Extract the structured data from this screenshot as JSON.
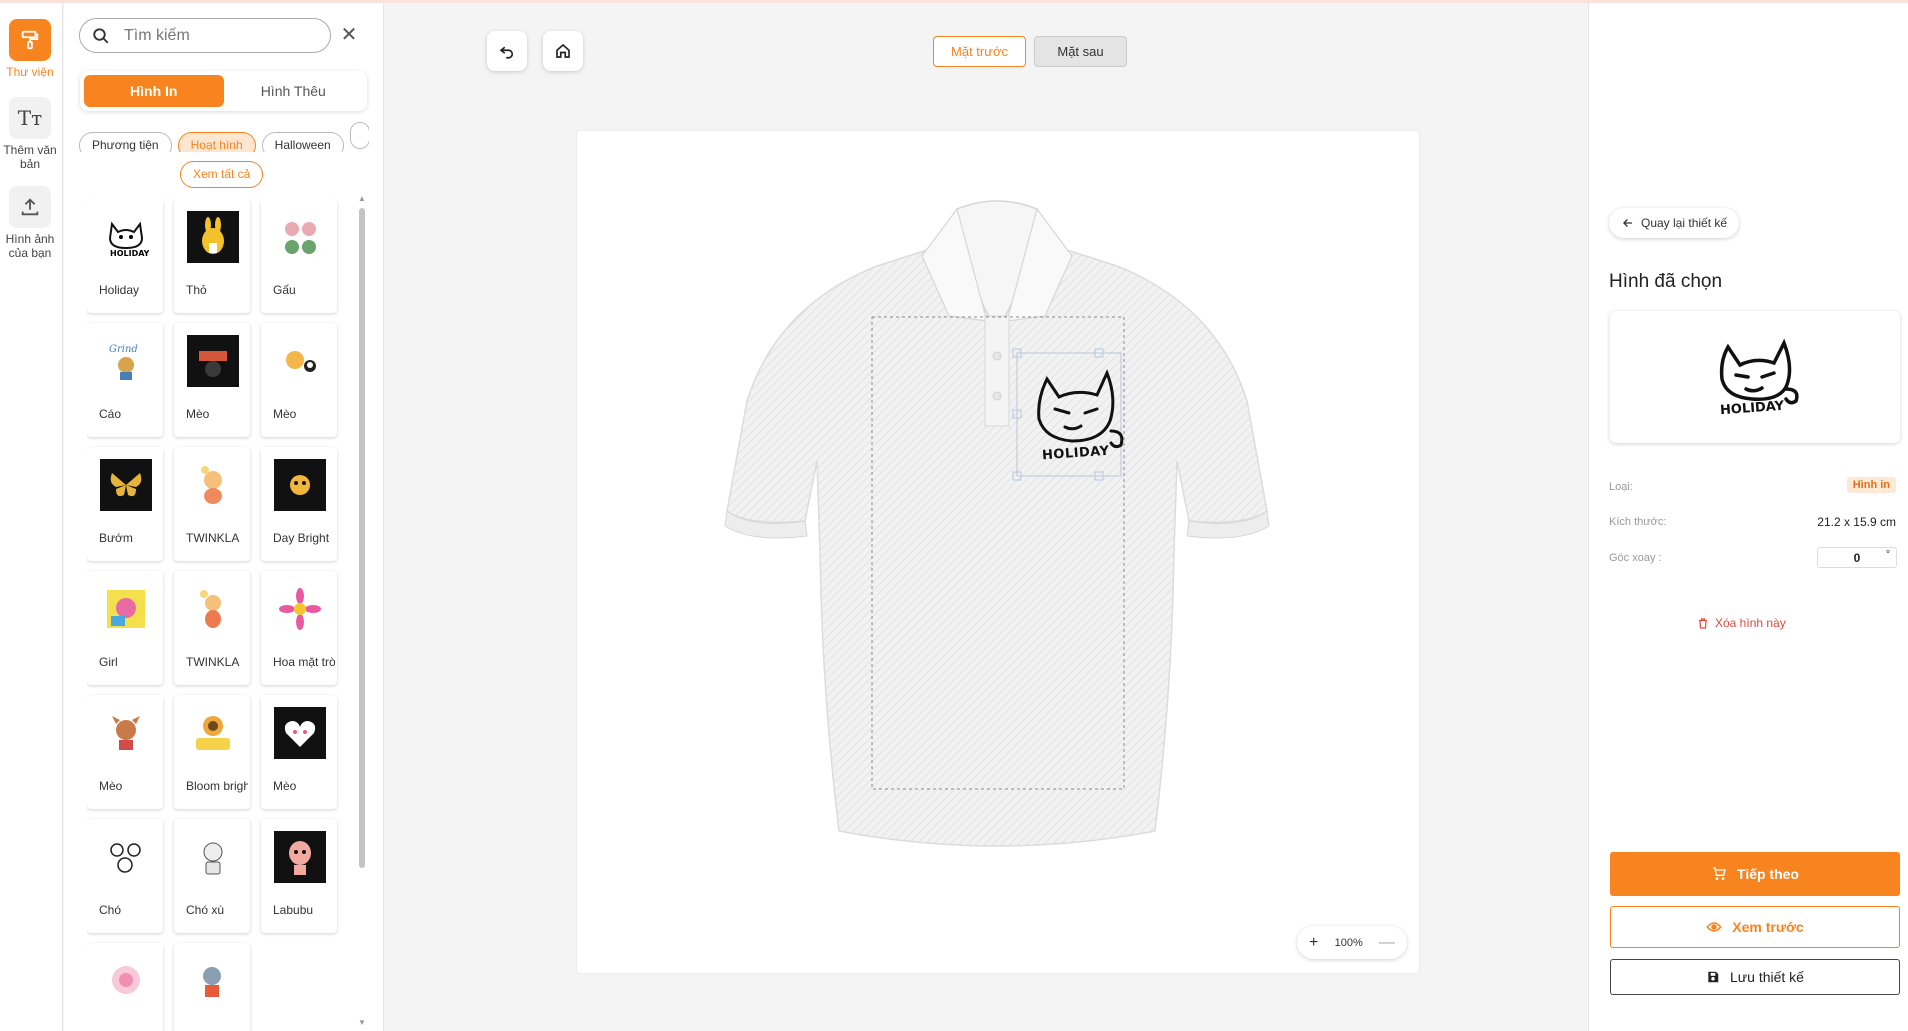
{
  "rail": {
    "items": [
      {
        "label": "Thư viện",
        "icon": "paint-roller-icon"
      },
      {
        "label": "Thêm văn bản",
        "icon": "text-icon"
      },
      {
        "label": "Hình ảnh của bạn",
        "icon": "upload-icon"
      }
    ]
  },
  "library": {
    "search_placeholder": "Tìm kiếm",
    "tabs": [
      {
        "label": "Hình In",
        "active": true
      },
      {
        "label": "Hình Thêu",
        "active": false
      }
    ],
    "categories": [
      {
        "label": "Phương tiện",
        "active": false
      },
      {
        "label": "Hoạt hình",
        "active": true
      },
      {
        "label": "Halloween",
        "active": false
      }
    ],
    "see_all": "Xem tất cả",
    "items": [
      {
        "name": "Holiday"
      },
      {
        "name": "Thỏ"
      },
      {
        "name": "Gấu"
      },
      {
        "name": "Cáo"
      },
      {
        "name": "Mèo"
      },
      {
        "name": "Mèo"
      },
      {
        "name": "Bướm"
      },
      {
        "name": "TWINKLA"
      },
      {
        "name": "Day Bright"
      },
      {
        "name": "Girl"
      },
      {
        "name": "TWINKLA"
      },
      {
        "name": "Hoa mặt trời"
      },
      {
        "name": "Mèo"
      },
      {
        "name": "Bloom bright"
      },
      {
        "name": "Mèo"
      },
      {
        "name": "Chó"
      },
      {
        "name": "Chó xù"
      },
      {
        "name": "Labubu"
      },
      {
        "name": ""
      },
      {
        "name": ""
      }
    ]
  },
  "toolbar": {
    "side_front": "Mặt trước",
    "side_back": "Mặt sau"
  },
  "canvas": {
    "design_text": "HOLIDAY",
    "zoom": "100%"
  },
  "panel": {
    "back": "Quay lại thiết kế",
    "title": "Hình đã chọn",
    "preview_text": "HOLIDAY",
    "type_label": "Loại:",
    "type_value": "Hình in",
    "size_label": "Kích thước:",
    "size_value": "21.2 x 15.9 cm",
    "angle_label": "Góc xoay :",
    "angle_value": "0",
    "angle_unit": "°",
    "delete": "Xóa hình này",
    "next": "Tiếp theo",
    "preview": "Xem trước",
    "save": "Lưu thiết kế"
  },
  "colors": {
    "accent": "#f7841e",
    "danger": "#e14a3e"
  }
}
